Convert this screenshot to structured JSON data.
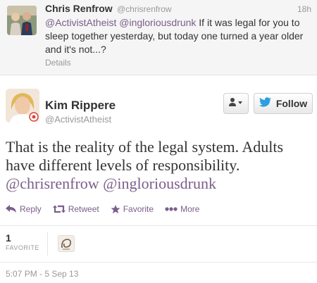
{
  "parent_tweet": {
    "name": "Chris Renfrow",
    "handle": "@chrisrenfrow",
    "time": "18h",
    "mention_1": "@ActivistAtheist",
    "mention_2": "@ingloriousdrunk",
    "text_line1_rest": " If it was legal for you to",
    "text_line2": "sleep together yesterday, but today one turned a year older",
    "text_line3": "and it's not...?",
    "details_label": "Details"
  },
  "tweet": {
    "name": "Kim Rippere",
    "handle": "@ActivistAtheist",
    "follow_label": "Follow",
    "text_line1": "That is the reality of the legal system. Adults",
    "text_line2": "have different levels of responsibility.",
    "mention_1": "@chrisrenfrow",
    "mention_2": "@ingloriousdrunk",
    "actions": {
      "reply": "Reply",
      "retweet": "Retweet",
      "favorite": "Favorite",
      "more": "More"
    },
    "stats": {
      "favorite_count": "1",
      "favorite_label": "FAVORITE"
    },
    "timestamp": "5:07 PM - 5 Sep 13"
  },
  "colors": {
    "mention": "#7b5e8a",
    "muted": "#999999",
    "follow_bird": "#2b9fe0"
  },
  "icons": [
    "user-dropdown-icon",
    "twitter-bird-icon",
    "reply-icon",
    "retweet-icon",
    "star-icon",
    "more-dots-icon"
  ]
}
